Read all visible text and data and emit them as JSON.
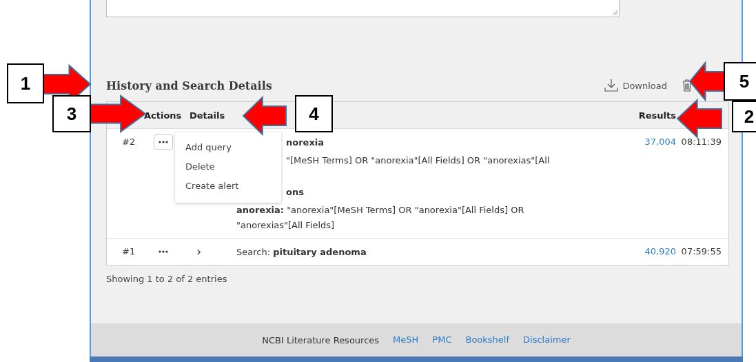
{
  "heading": "History and Search Details",
  "toolbar": [
    {
      "kind": "download",
      "label": "Download"
    },
    {
      "kind": "delete"
    }
  ],
  "table": {
    "columns": {
      "actions": "Actions",
      "details": "Details",
      "results": "Results"
    },
    "rows": [
      {
        "number": "#2",
        "menu_open": true,
        "lines": [
          {
            "kind": "title",
            "covered": true,
            "text": "norexia"
          },
          {
            "kind": "text",
            "covered": true,
            "text": "\"[MeSH Terms] OR \"anorexia\"[All Fields] OR \"anorexias\"[All"
          },
          {
            "kind": "title",
            "covered": true,
            "text": "ons"
          },
          {
            "kind": "text",
            "covered": false,
            "text": "**anorexia:** \"anorexia\"[MeSH Terms] OR \"anorexia\"[All Fields] OR \"anorexias\"[All Fields]"
          }
        ],
        "results": "37,004",
        "time": "08:11:39"
      },
      {
        "number": "#1",
        "menu_open": false,
        "chevron": "›",
        "lines": [
          {
            "kind": "text",
            "covered": false,
            "text": "Search: **pituitary adenoma**"
          }
        ],
        "results": "40,920",
        "time": "07:59:55"
      }
    ]
  },
  "menu": {
    "items": [
      "Add query",
      "Delete",
      "Create alert"
    ]
  },
  "entries": "Showing 1 to 2 of 2 entries",
  "footer": [
    {
      "text": "NCBI Literature Resources",
      "link": false
    },
    {
      "text": "MeSH",
      "link": true
    },
    {
      "text": "PMC",
      "link": true
    },
    {
      "text": "Bookshelf",
      "link": true
    },
    {
      "text": "Disclaimer",
      "link": true
    }
  ],
  "callouts": [
    {
      "number": "1",
      "kind": "right"
    },
    {
      "number": "3",
      "kind": "right"
    },
    {
      "number": "4",
      "kind": "left"
    },
    {
      "number": "5",
      "kind": "left"
    },
    {
      "number": "2",
      "kind": "left"
    }
  ]
}
